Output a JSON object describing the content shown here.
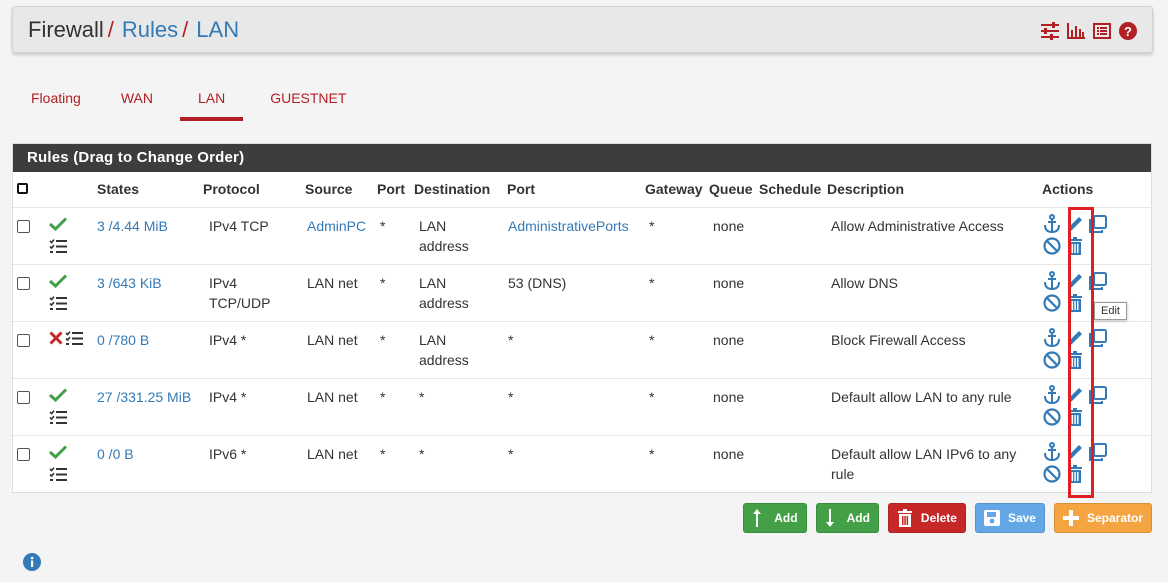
{
  "breadcrumb": {
    "items": [
      "Firewall",
      "Rules",
      "LAN"
    ],
    "separator": "/"
  },
  "header_icons": [
    "sliders-icon",
    "bar-chart-icon",
    "list-icon",
    "help-icon"
  ],
  "tabs": [
    {
      "label": "Floating",
      "active": false
    },
    {
      "label": "WAN",
      "active": false
    },
    {
      "label": "LAN",
      "active": true
    },
    {
      "label": "GUESTNET",
      "active": false
    }
  ],
  "panel": {
    "title": "Rules (Drag to Change Order)"
  },
  "columns": [
    "States",
    "Protocol",
    "Source",
    "Port",
    "Destination",
    "Port",
    "Gateway",
    "Queue",
    "Schedule",
    "Description",
    "Actions"
  ],
  "rules": [
    {
      "status": "pass",
      "states": "3 /4.44 MiB",
      "protocol": "IPv4 TCP",
      "source": "AdminPC",
      "source_link": true,
      "src_port": "*",
      "destination": "LAN address",
      "dst_port": "AdministrativePorts",
      "dst_port_link": true,
      "gateway": "*",
      "queue": "none",
      "schedule": "",
      "description": "Allow Administrative Access"
    },
    {
      "status": "pass",
      "states": "3 /643 KiB",
      "protocol": "IPv4 TCP/UDP",
      "source": "LAN net",
      "source_link": false,
      "src_port": "*",
      "destination": "LAN address",
      "dst_port": "53 (DNS)",
      "dst_port_link": false,
      "gateway": "*",
      "queue": "none",
      "schedule": "",
      "description": "Allow DNS"
    },
    {
      "status": "block",
      "states": "0 /780 B",
      "protocol": "IPv4 *",
      "source": "LAN net",
      "source_link": false,
      "src_port": "*",
      "destination": "LAN address",
      "dst_port": "*",
      "dst_port_link": false,
      "gateway": "*",
      "queue": "none",
      "schedule": "",
      "description": "Block Firewall Access"
    },
    {
      "status": "pass",
      "states": "27 /331.25 MiB",
      "protocol": "IPv4 *",
      "source": "LAN net",
      "source_link": false,
      "src_port": "*",
      "destination": "*",
      "dst_port": "*",
      "dst_port_link": false,
      "gateway": "*",
      "queue": "none",
      "schedule": "",
      "description": "Default allow LAN to any rule"
    },
    {
      "status": "pass",
      "states": "0 /0 B",
      "protocol": "IPv6 *",
      "source": "LAN net",
      "source_link": false,
      "src_port": "*",
      "destination": "*",
      "dst_port": "*",
      "dst_port_link": false,
      "gateway": "*",
      "queue": "none",
      "schedule": "",
      "description": "Default allow LAN IPv6 to any rule"
    }
  ],
  "tooltip": "Edit",
  "buttons": {
    "add_top": "Add",
    "add_bottom": "Add",
    "delete": "Delete",
    "save": "Save",
    "separator": "Separator"
  },
  "colors": {
    "accent_red": "#b21f24",
    "link_blue": "#337ab7",
    "pass_green": "#43a047",
    "block_red": "#c62828",
    "highlight_red": "#e01f25"
  }
}
